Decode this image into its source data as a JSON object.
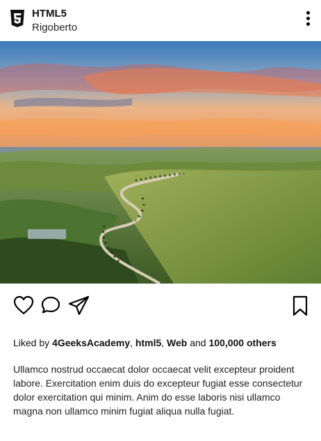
{
  "post": {
    "account_name": "HTML5",
    "username": "Rigoberto",
    "account_icon": "html5-logo-icon",
    "menu_icon": "more-vertical-icon",
    "image_alt": "Cypress-lined winding road through green rolling hills at sunset"
  },
  "actions": {
    "like_icon": "heart-icon",
    "comment_icon": "comment-icon",
    "share_icon": "send-icon",
    "save_icon": "bookmark-icon"
  },
  "likes": {
    "prefix": "Liked by ",
    "user1": "4GeeksAcademy",
    "sep1": ", ",
    "user2": "html5",
    "sep2": ", ",
    "user3": "Web",
    "and": " and ",
    "others": "100,000 others"
  },
  "caption": "Ullamco nostrud occaecat dolor occaecat velit excepteur proident labore. Exercitation enim duis do excepteur fugiat esse consectetur dolor exercitation qui minim. Anim do esse laboris nisi ullamco magna non ullamco minim fugiat aliqua nulla fugiat.",
  "colors": {
    "text": "#111111",
    "sky_top": "#3b7ab8",
    "sunset_orange": "#f0884a",
    "hills_green": "#5f8a3a"
  }
}
